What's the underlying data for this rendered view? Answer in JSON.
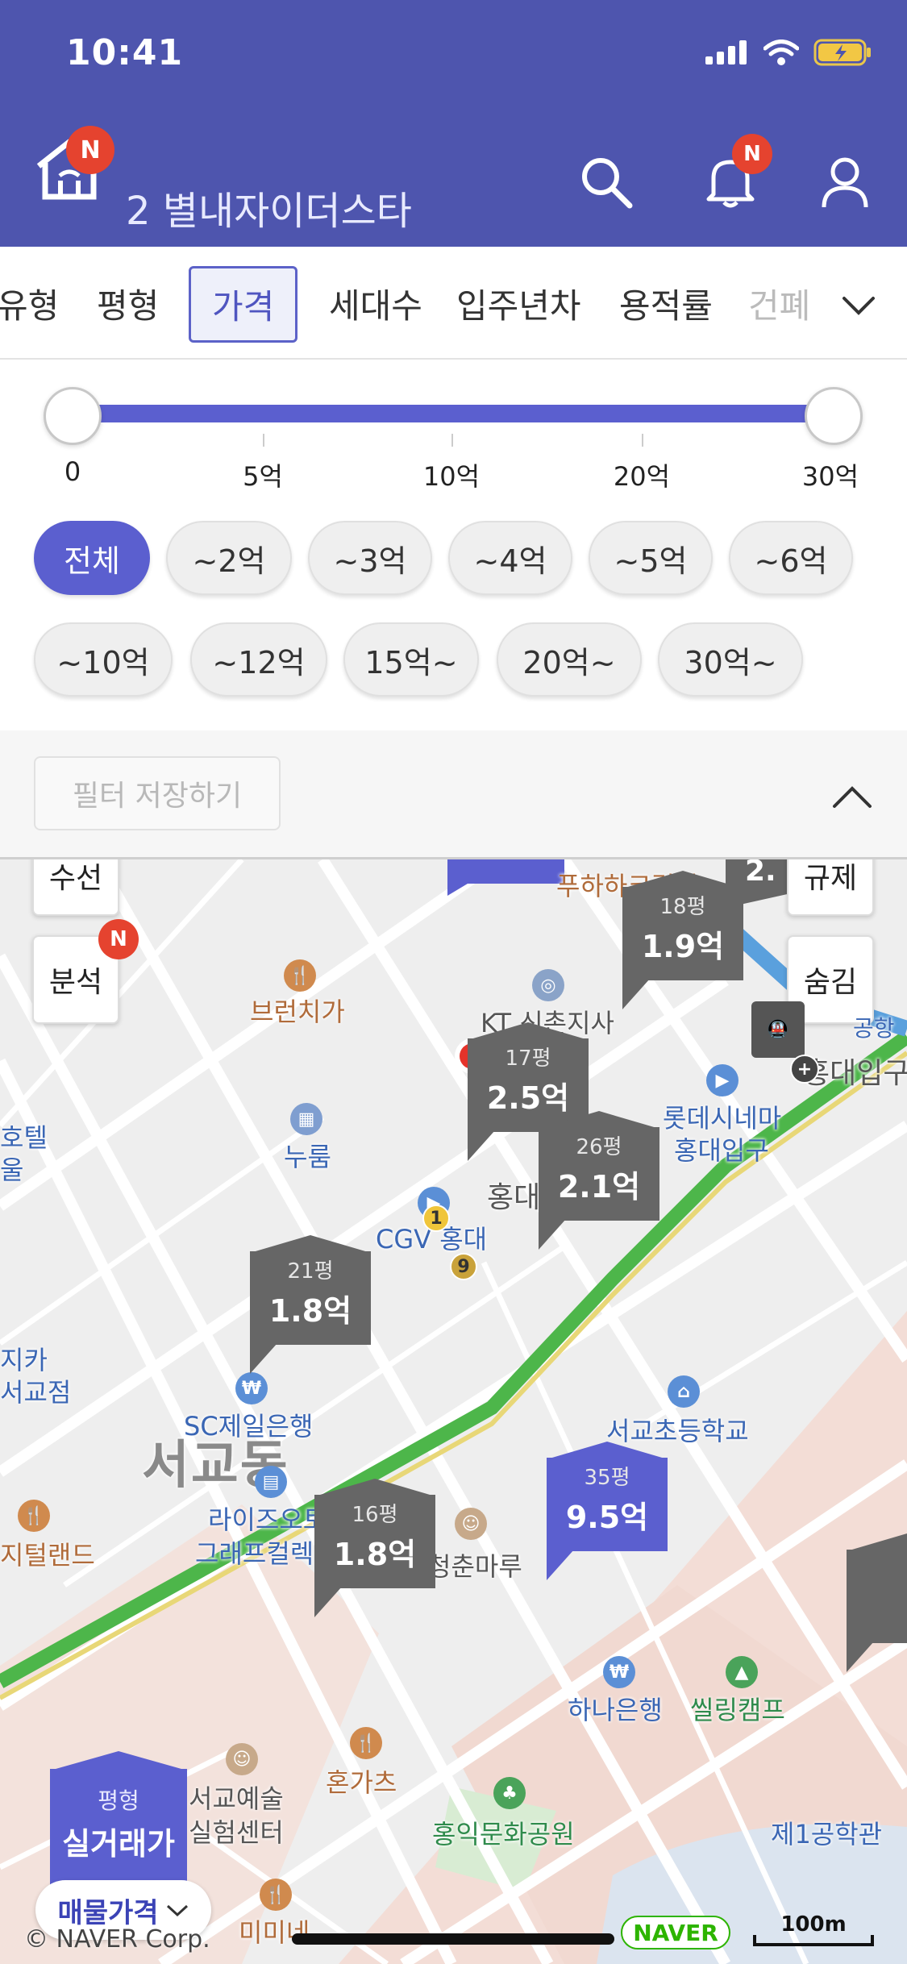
{
  "status_bar": {
    "time": "10:41"
  },
  "header": {
    "home_badge": "N",
    "title": "2  별내자이더스타",
    "notif_badge": "N",
    "bg_color": "#4e55ae"
  },
  "tabs": [
    "유형",
    "평형",
    "가격",
    "세대수",
    "입주년차",
    "용적률",
    "건폐"
  ],
  "selected_tab": "가격",
  "price_slider": {
    "min": "0",
    "max": "30억",
    "ticks": [
      "0",
      "5억",
      "10억",
      "20억",
      "30억"
    ],
    "range": [
      "0",
      "30억"
    ]
  },
  "price_chips": {
    "row1": [
      "전체",
      "~2억",
      "~3억",
      "~4억",
      "~5억",
      "~6억"
    ],
    "row2": [
      "~10억",
      "~12억",
      "15억~",
      "20억~",
      "30억~"
    ],
    "active": "전체"
  },
  "save_filter": {
    "label": "필터 저장하기"
  },
  "map": {
    "left_buttons": {
      "top_partial": "수선",
      "analysis": "분석",
      "analysis_badge": "N"
    },
    "right_buttons": {
      "top_partial": "규제",
      "hide": "숨김"
    },
    "labels": {
      "brunch": "브런치가",
      "kt": "KT 신촌지사",
      "hotel_1": "호텔",
      "hotel_2": "울",
      "nurum": "누룸",
      "hongdae_station": "홍대",
      "cgv": "CGV 홍대",
      "lotte_1": "롯데시네마",
      "lotte_2": "홍대입구",
      "hongdae_entrance": "홍대입구",
      "airport": "공항",
      "digica_1": "지카",
      "digica_2": "서교점",
      "sc_bank": "SC제일은행",
      "seogyo_dong": "서교동",
      "seogyo_school": "서교초등학교",
      "rise_1": "라이즈오토",
      "rise_2": "그래프컬렉",
      "digital_land": "지털랜드",
      "cheongchun": "청춘마루",
      "hana": "하나은행",
      "ssling": "씰링캠프",
      "art_1": "서교예술",
      "art_2": "실험센터",
      "honkatsu": "혼가츠",
      "park": "홍익문화공원",
      "tech_school": "제1공학관",
      "mimine": "미미네",
      "puhaha": "푸하하크림빵"
    },
    "line_badges": [
      "1",
      "9"
    ],
    "markers": [
      {
        "area": "18평",
        "price": "1.9억",
        "color": "#666666"
      },
      {
        "area": "17평",
        "price": "2.5억",
        "color": "#666666"
      },
      {
        "area": "26평",
        "price": "2.1억",
        "color": "#666666"
      },
      {
        "area": "21평",
        "price": "1.8억",
        "color": "#666666"
      },
      {
        "area": "16평",
        "price": "1.8억",
        "color": "#666666"
      },
      {
        "area": "35평",
        "price": "9.5억",
        "color": "#5b5fcf"
      }
    ],
    "partial_marker": "2.",
    "legend": {
      "sub": "평형",
      "main": "실거래가"
    },
    "sale_price_button": "매물가격",
    "copyright": "© NAVER Corp.",
    "naver_logo": "NAVER",
    "scale": "100m"
  }
}
